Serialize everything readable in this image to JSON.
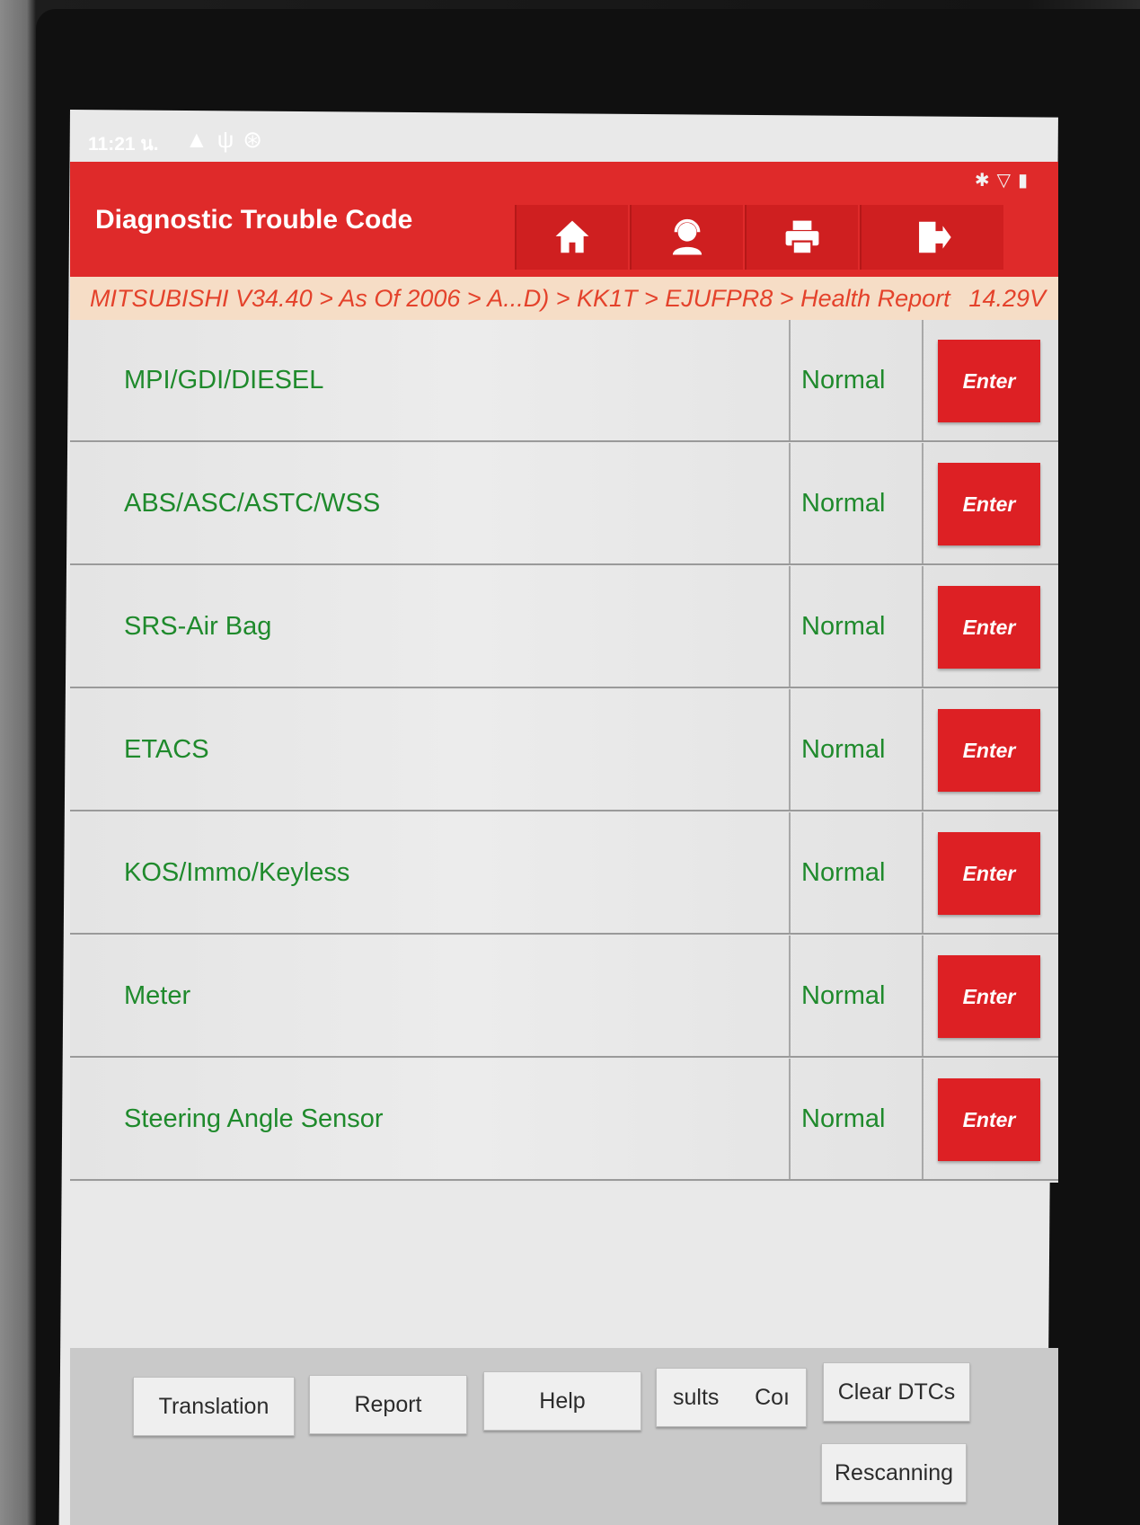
{
  "status": {
    "time": "11:21 น.",
    "icons": [
      "warning-icon",
      "usb-icon",
      "settings-icon"
    ],
    "right_icons": [
      "bluetooth-icon",
      "wifi-icon",
      "battery-icon"
    ]
  },
  "header": {
    "title": "Diagnostic Trouble Code",
    "tools": [
      "home-icon",
      "support-icon",
      "print-icon",
      "exit-icon"
    ]
  },
  "breadcrumb": {
    "path": "MITSUBISHI V34.40 > As Of 2006 > A...D) > KK1T > EJUFPR8 > Health Report",
    "voltage": "14.29V"
  },
  "systems": [
    {
      "name": "MPI/GDI/DIESEL",
      "status": "Normal",
      "action": "Enter"
    },
    {
      "name": "ABS/ASC/ASTC/WSS",
      "status": "Normal",
      "action": "Enter"
    },
    {
      "name": "SRS-Air Bag",
      "status": "Normal",
      "action": "Enter"
    },
    {
      "name": "ETACS",
      "status": "Normal",
      "action": "Enter"
    },
    {
      "name": "KOS/Immo/Keyless",
      "status": "Normal",
      "action": "Enter"
    },
    {
      "name": "Meter",
      "status": "Normal",
      "action": "Enter"
    },
    {
      "name": "Steering Angle Sensor",
      "status": "Normal",
      "action": "Enter"
    }
  ],
  "bottom": {
    "translation": "Translation",
    "report": "Report",
    "help": "Help",
    "results_left": "sults",
    "results_right": "Coı",
    "clear_dtcs": "Clear DTCs",
    "rescanning": "Rescanning"
  },
  "colors": {
    "header": "#df2a2a",
    "enter_button": "#dd2024",
    "system_text": "#1f8a2c",
    "breadcrumb_text": "#e4422b"
  }
}
